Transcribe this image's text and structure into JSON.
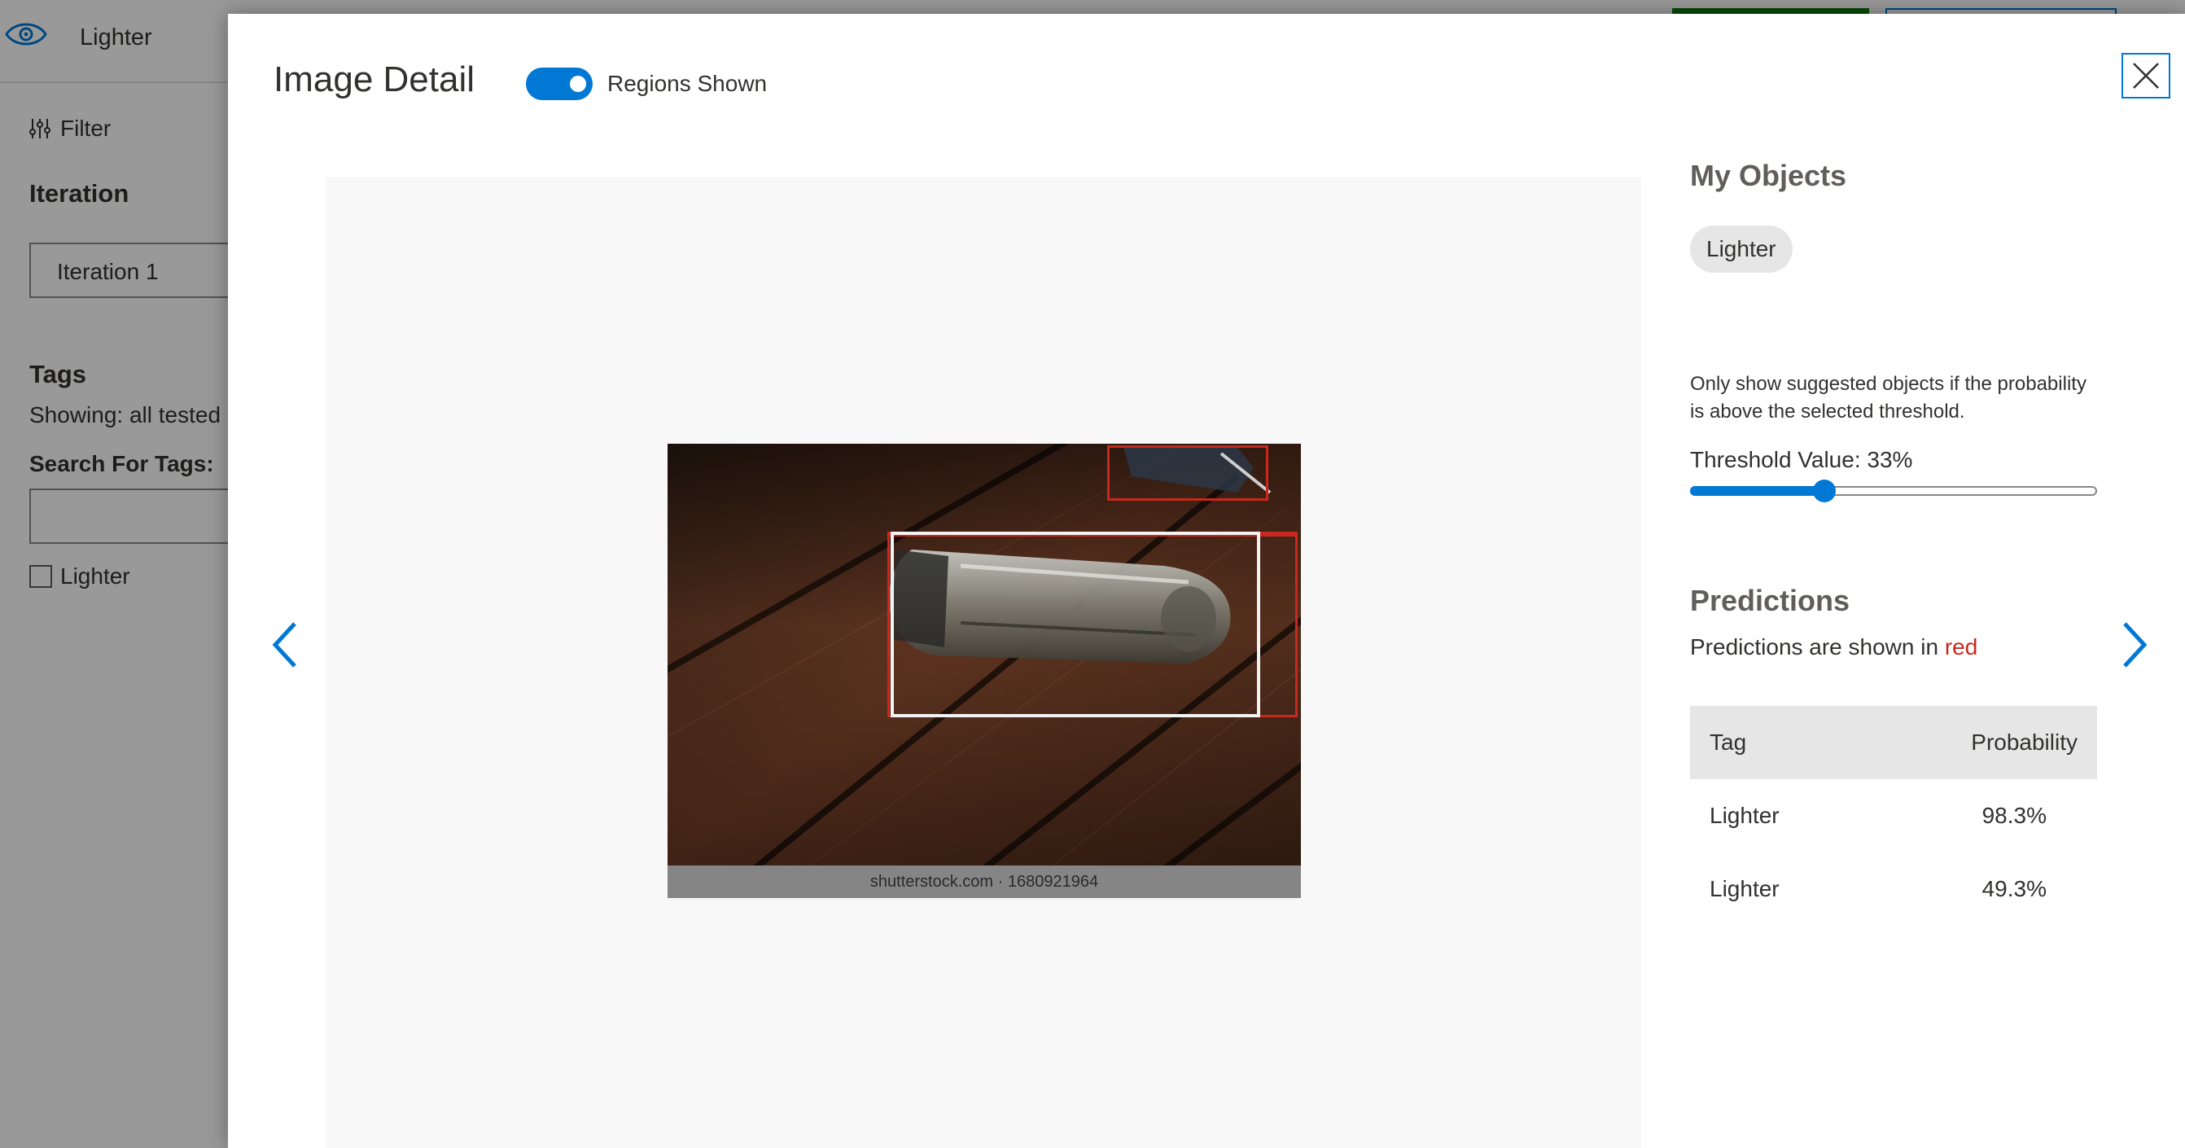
{
  "app": {
    "title": "Lighter",
    "filter_label": "Filter",
    "iteration_heading": "Iteration",
    "iteration_value": "Iteration 1",
    "tags_heading": "Tags",
    "showing_text": "Showing: all tested i",
    "search_label": "Search For Tags:",
    "search_value": "",
    "tag_items": [
      "Lighter"
    ]
  },
  "modal": {
    "title": "Image Detail",
    "toggle_label": "Regions Shown",
    "toggle_on": true
  },
  "image": {
    "watermark": "shutterstock.com · 1680921964"
  },
  "panel": {
    "objects_heading": "My Objects",
    "object_chip": "Lighter",
    "threshold_help": "Only show suggested objects if the probability is above the selected threshold.",
    "threshold_label": "Threshold Value: 33%",
    "threshold_value": 33,
    "predictions_heading": "Predictions",
    "predictions_note_prefix": "Predictions are shown in ",
    "predictions_note_color_word": "red",
    "table": {
      "headers": [
        "Tag",
        "Probability"
      ],
      "rows": [
        {
          "tag": "Lighter",
          "probability": "98.3%"
        },
        {
          "tag": "Lighter",
          "probability": "49.3%"
        }
      ]
    }
  },
  "colors": {
    "accent": "#0078d4",
    "prediction_red": "#c8281e",
    "top_button_green": "#107c10"
  },
  "icons": [
    "eye-logo-icon",
    "filter-icon",
    "close-icon",
    "chevron-left-icon",
    "chevron-right-icon"
  ]
}
